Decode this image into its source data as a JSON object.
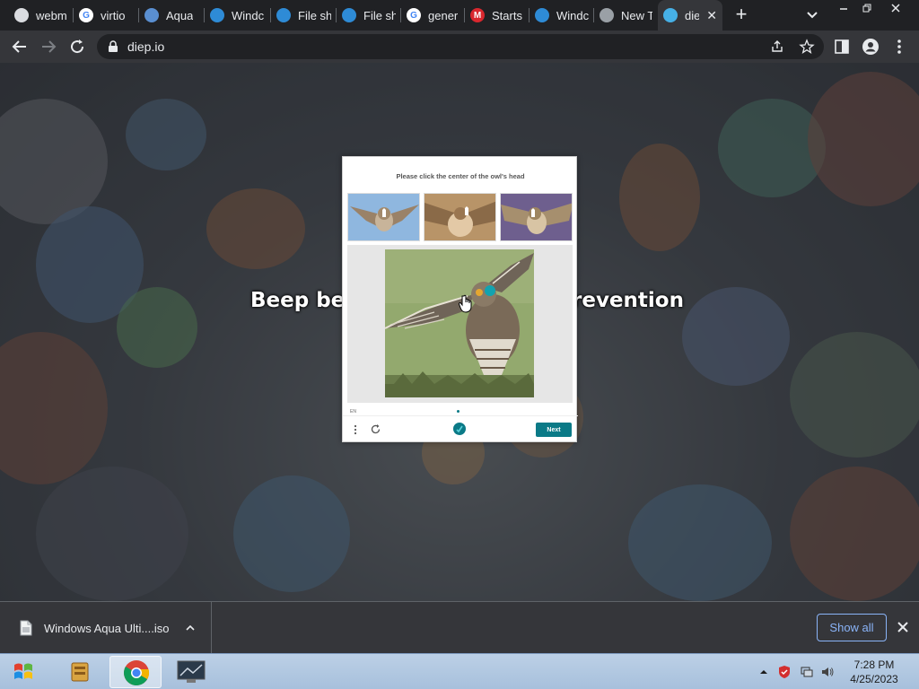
{
  "browser": {
    "tabs": [
      {
        "title": "webm",
        "icon": "generic-site-icon",
        "color": "#dadce0"
      },
      {
        "title": "virtio",
        "icon": "google-icon",
        "color": "#ffffff"
      },
      {
        "title": "Aqua",
        "icon": "aqua-site-icon",
        "color": "#5a8fd1"
      },
      {
        "title": "Windc",
        "icon": "edge-icon",
        "color": "#2e8bd6"
      },
      {
        "title": "File sh",
        "icon": "edge-icon",
        "color": "#2e8bd6"
      },
      {
        "title": "File sh",
        "icon": "edge-icon",
        "color": "#2e8bd6"
      },
      {
        "title": "gener",
        "icon": "google-icon",
        "color": "#ffffff"
      },
      {
        "title": "Starts",
        "icon": "mega-icon",
        "color": "#d9272e"
      },
      {
        "title": "Windc",
        "icon": "edge-icon",
        "color": "#2e8bd6"
      },
      {
        "title": "New T",
        "icon": "chrome-icon",
        "color": "#9aa0a6"
      },
      {
        "title": "die",
        "icon": "diep-icon",
        "color": "#46b0e6",
        "active": true
      }
    ],
    "url": "diep.io"
  },
  "page": {
    "banner_left": "Beep bee",
    "banner_right": "revention"
  },
  "captcha": {
    "prompt": "Please click the center of the owl's head",
    "language": "EN",
    "next_label": "Next"
  },
  "downloads": {
    "file_name": "Windows Aqua Ulti....iso",
    "show_all_label": "Show all"
  },
  "taskbar": {
    "time": "7:28 PM",
    "date": "4/25/2023"
  },
  "colors": {
    "accent": "#0b7a87",
    "chrome_dark": "#202124",
    "chrome_toolbar": "#35363a"
  }
}
